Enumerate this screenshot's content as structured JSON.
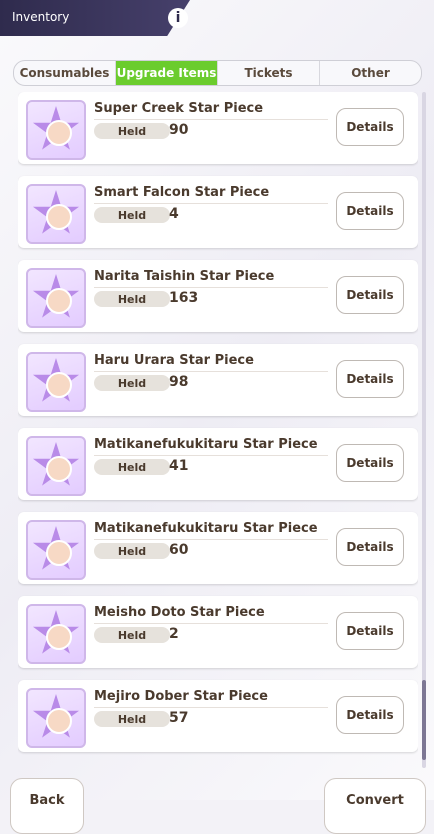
{
  "header": {
    "title": "Inventory"
  },
  "tabs": [
    {
      "label": "Consumables",
      "active": false
    },
    {
      "label": "Upgrade Items",
      "active": true
    },
    {
      "label": "Tickets",
      "active": false
    },
    {
      "label": "Other",
      "active": false
    }
  ],
  "items": [
    {
      "name": "Super Creek Star Piece",
      "held_label": "Held",
      "held": "90",
      "details_label": "Details"
    },
    {
      "name": "Smart Falcon Star Piece",
      "held_label": "Held",
      "held": "4",
      "details_label": "Details"
    },
    {
      "name": "Narita Taishin Star Piece",
      "held_label": "Held",
      "held": "163",
      "details_label": "Details"
    },
    {
      "name": "Haru Urara Star Piece",
      "held_label": "Held",
      "held": "98",
      "details_label": "Details"
    },
    {
      "name": "Matikanefukukitaru Star Piece",
      "held_label": "Held",
      "held": "41",
      "details_label": "Details"
    },
    {
      "name": "Matikanefukukitaru Star Piece",
      "held_label": "Held",
      "held": "60",
      "details_label": "Details"
    },
    {
      "name": "Meisho Doto Star Piece",
      "held_label": "Held",
      "held": "2",
      "details_label": "Details"
    },
    {
      "name": "Mejiro Dober Star Piece",
      "held_label": "Held",
      "held": "57",
      "details_label": "Details"
    }
  ],
  "footer": {
    "back_label": "Back",
    "convert_label": "Convert"
  }
}
